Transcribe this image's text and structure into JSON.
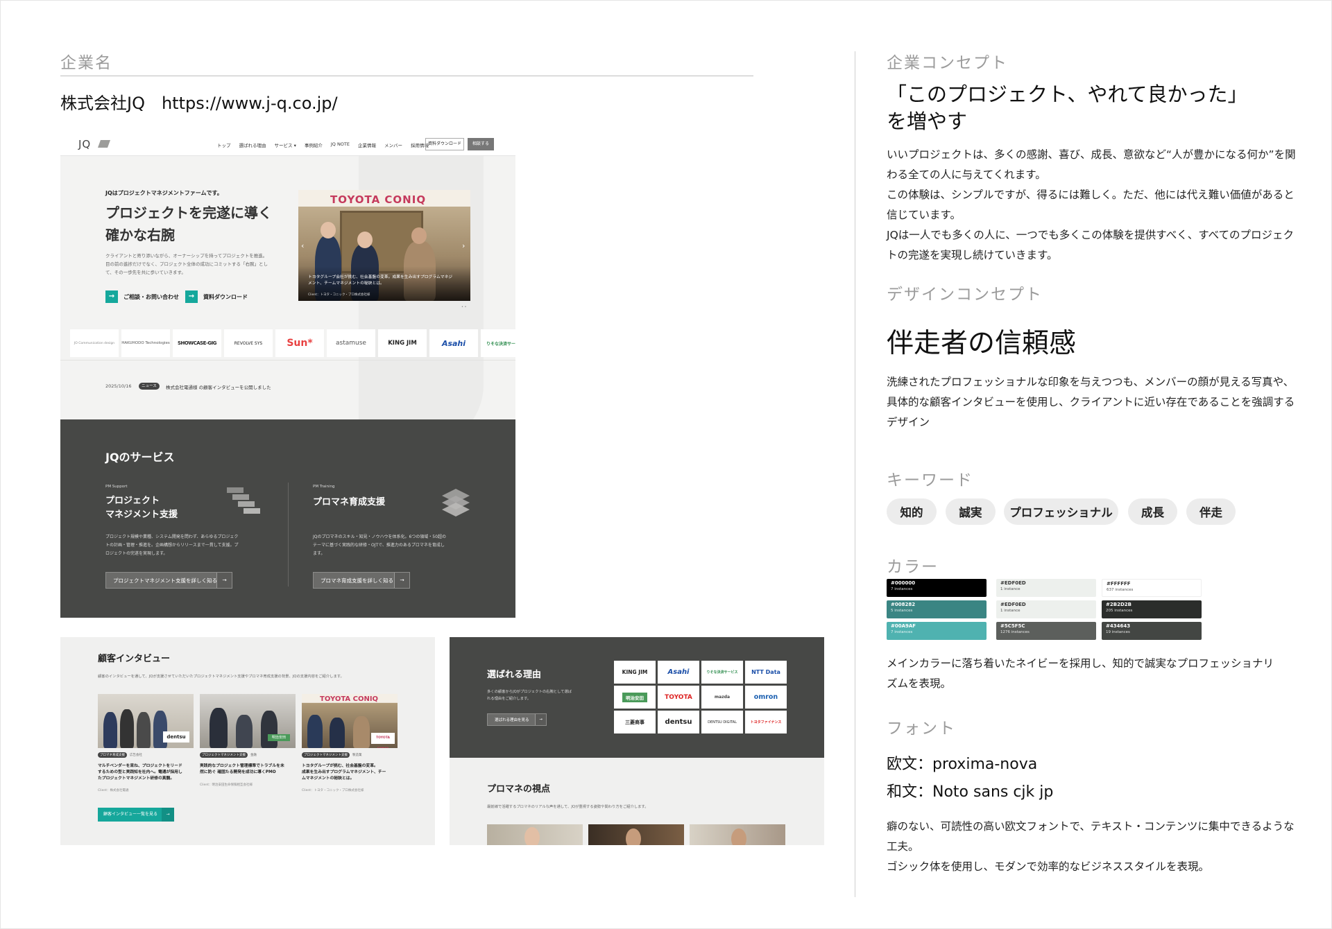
{
  "left": {
    "company_label": "企業名",
    "company_line": "株式会社JQ　https://www.j-q.co.jp/"
  },
  "mock_main": {
    "logo": "JQ",
    "nav": [
      "トップ",
      "選ばれる理由",
      "サービス ▾",
      "事例紹介",
      "JQ NOTE",
      "企業情報",
      "メンバー",
      "採用情報"
    ],
    "nav_btn1": "資料ダウンロード",
    "nav_btn2": "相談する",
    "eyebrow": "JQはプロジェクトマネジメントファームです。",
    "hero_title_1": "プロジェクトを完遂に導く",
    "hero_title_2": "確かな右腕",
    "hero_desc_1": "クライアントと寄り添いながら、オーナーシップを持ってプロジェクトを推進。",
    "hero_desc_2": "目の前の進捗だけでなく、プロジェクト全体の成功にコミットする「右腕」とし",
    "hero_desc_3": "て、その一歩先を共に歩いていきます。",
    "cta1": "ご相談・お問い合わせ",
    "cta2": "資料ダウンロード",
    "slide_brand": "TOYOTA CONIQ",
    "slide_caption_1": "トヨタグループ会社が挑む、社会基盤の変革。成果を生み出すプログラムマネジ",
    "slide_caption_2": "メント、チームマネジメントの秘訣とは。",
    "slide_client": "Client：トヨタ・コニック・プロ株式会社様",
    "logos": [
      "JO Communication design",
      "HAKUHODO Technologies",
      "SHOWCASE-GIG",
      "REVOLVE SYS",
      "Sun*",
      "astamuse",
      "KING JIM",
      "Asahi",
      "りそな決済サービス"
    ],
    "news_date": "2025/10/16",
    "news_tag": "ニュース",
    "news_text": "株式会社電通様 の顧客インタビューを公開しました",
    "services_title": "JQのサービス",
    "svc1_eyebrow": "PM Support",
    "svc1_title_1": "プロジェクト",
    "svc1_title_2": "マネジメント支援",
    "svc1_desc_1": "プロジェクト規模や業種、システム開発を問わず、あらゆるプロジェク",
    "svc1_desc_2": "トの計画・管理・推進を。企画構想からリリースまで一貫して支援。プ",
    "svc1_desc_3": "ロジェクトの完遂を実現します。",
    "svc1_btn": "プロジェクトマネジメント支援を詳しく知る",
    "svc2_eyebrow": "PM Training",
    "svc2_title": "プロマネ育成支援",
    "svc2_desc_1": "JQのプロマネのスキル・知見・ノウハウを体系化。6つの領域・50超の",
    "svc2_desc_2": "テーマに基づく実践的な研修・OJTで、推進力のあるプロマネを育成し",
    "svc2_desc_3": "ます。",
    "svc2_btn": "プロマネ育成支援を詳しく知る",
    "arrow": "→"
  },
  "mock_interview": {
    "title": "顧客インタビュー",
    "desc": "顧客のインタビューを通して、JQが支援させていただいたプロジェクトマネジメント支援やプロマネ育成支援の背景、JQの支援内容をご紹介します。",
    "cards": [
      {
        "tag": "プロマネ育成支援",
        "sub": "広告会社",
        "text_1": "マルチベンダーを束ね、プロジェクトをリード",
        "text_2": "するための型と実践知を社内へ。電通が採用し",
        "text_3": "たプロジェクトマネジメント研修の真髄。",
        "client": "Client：株式会社電通",
        "brand": "dentsu"
      },
      {
        "tag": "プロジェクトマネジメント支援",
        "sub": "金融",
        "text_1": "実践的なプロジェクト管理標準でトラブルを未",
        "text_2": "然に防ぐ 確固たる開発を成功に導くPMO",
        "text_3": "",
        "client": "Client：明治安田生命保険相互会社様",
        "brand": "明治安田"
      },
      {
        "tag": "プロジェクトマネジメント支援",
        "sub": "製造業",
        "text_1": "トヨタグループが挑む、社会基盤の変革。",
        "text_2": "成果を生み出すプログラムマネジメント、チー",
        "text_3": "ムマネジメントの秘訣とは。",
        "client": "Client：トヨタ・コニック・プロ株式会社様",
        "brand": "TOYOTA CONIQ"
      }
    ],
    "btn": "顧客インタビュー一覧を見る"
  },
  "mock_reason": {
    "title": "選ばれる理由",
    "desc_1": "多くの顧客からJQがプロジェクトの右腕として選ば",
    "desc_2": "れる理由をご紹介します。",
    "btn": "選ばれる理由を見る",
    "logos": [
      "KING JIM",
      "Asahi",
      "りそな決済サービス",
      "NTT Data",
      "明治安田",
      "TOYOTA",
      "mazda",
      "omron",
      "三菱商事",
      "dentsu",
      "DENTSU DIGITAL",
      "トヨタファイナンス"
    ],
    "pov_title": "プロマネの視点",
    "pov_desc": "最前線で活躍するプロマネのリアルな声を通して、JQが重視する姿勢や関わり方をご紹介します。"
  },
  "right": {
    "concept_label": "企業コンセプト",
    "concept_heading_1": "「このプロジェクト、やれて良かった」",
    "concept_heading_2": "を増やす",
    "concept_p1": "いいプロジェクトは、多くの感謝、喜び、成長、意欲など“人が豊かになる何か”を関",
    "concept_p2": "わる全ての人に与えてくれます。",
    "concept_p3": "この体験は、シンプルですが、得るには難しく。ただ、他には代え難い価値があると",
    "concept_p4": "信じています。",
    "concept_p5": "JQは一人でも多くの人に、一つでも多くこの体験を提供すべく、すべてのプロジェク",
    "concept_p6": "トの完遂を実現し続けていきます。",
    "design_label": "デザインコンセプト",
    "design_heading": "伴走者の信頼感",
    "design_p1": "洗練されたプロフェッショナルな印象を与えつつも、メンバーの顔が見える写真や、",
    "design_p2": "具体的な顧客インタビューを使用し、クライアントに近い存在であることを強調する",
    "design_p3": "デザイン",
    "keyword_label": "キーワード",
    "keywords": [
      "知的",
      "誠実",
      "プロフェッショナル",
      "成長",
      "伴走"
    ],
    "color_label": "カラー",
    "swatches": [
      {
        "hex": "#000000",
        "count": "7 instances",
        "bg": "#000000",
        "fg": "#ffffff"
      },
      {
        "hex": "#EDF0ED",
        "count": "1 instance",
        "bg": "#edf0ed",
        "fg": "#333333"
      },
      {
        "hex": "#FFFFFF",
        "count": "637 instances",
        "bg": "#ffffff",
        "fg": "#333333"
      },
      {
        "hex": "#008282",
        "count": "5 instances",
        "bg": "#3a8583",
        "fg": "#ffffff"
      },
      {
        "hex": "#EDF0ED",
        "count": "1 instance",
        "bg": "#edf0ed",
        "fg": "#333333"
      },
      {
        "hex": "#2B2D2B",
        "count": "205 instances",
        "bg": "#2b2d2b",
        "fg": "#ffffff"
      },
      {
        "hex": "#00A9AF",
        "count": "7 instances",
        "bg": "#4fb2b0",
        "fg": "#ffffff"
      },
      {
        "hex": "#5C5F5C",
        "count": "1276 instances",
        "bg": "#5c5f5c",
        "fg": "#ffffff"
      },
      {
        "hex": "#434643",
        "count": "19 instances",
        "bg": "#434643",
        "fg": "#ffffff"
      }
    ],
    "color_p1": "メインカラーに落ち着いたネイビーを採用し、知的で誠実なプロフェッショナリ",
    "color_p2": "ズムを表現。",
    "font_label": "フォント",
    "font_en": "欧文：proxima-nova",
    "font_ja": "和文：Noto sans cjk jp",
    "font_p1": "癖のない、可読性の高い欧文フォントで、テキスト・コンテンツに集中できるような",
    "font_p2": "工夫。",
    "font_p3": "ゴシック体を使用し、モダンで効率的なビジネススタイルを表現。"
  }
}
